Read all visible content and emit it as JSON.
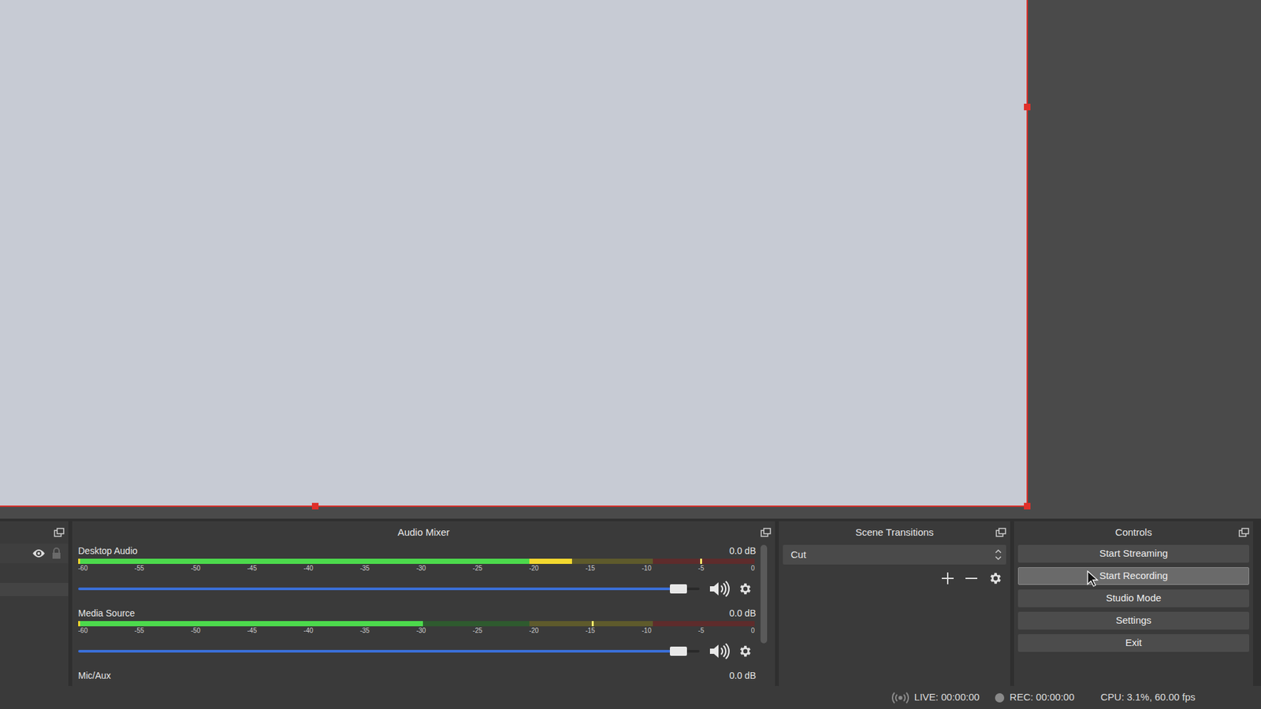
{
  "preview": {
    "selected": true
  },
  "sources_dock": {
    "items": [
      {
        "visible": true,
        "locked": false
      }
    ]
  },
  "audio_mixer": {
    "title": "Audio Mixer",
    "scale": [
      "-60",
      "-55",
      "-50",
      "-45",
      "-40",
      "-35",
      "-30",
      "-25",
      "-20",
      "-15",
      "-10",
      "-5",
      "0"
    ],
    "channels": [
      {
        "name": "Desktop Audio",
        "reading": "0.0 dB",
        "level": 0.73,
        "peak": 0.92,
        "volume": 0.98,
        "muted": false
      },
      {
        "name": "Media Source",
        "reading": "0.0 dB",
        "level": 0.51,
        "peak": 0.76,
        "volume": 0.98,
        "muted": false
      },
      {
        "name": "Mic/Aux",
        "reading": "0.0 dB"
      }
    ]
  },
  "scene_transitions": {
    "title": "Scene Transitions",
    "selected": "Cut"
  },
  "controls": {
    "title": "Controls",
    "buttons": [
      {
        "label": "Start Streaming",
        "hovered": false
      },
      {
        "label": "Start Recording",
        "hovered": true
      },
      {
        "label": "Studio Mode",
        "hovered": false
      },
      {
        "label": "Settings",
        "hovered": false
      },
      {
        "label": "Exit",
        "hovered": false
      }
    ]
  },
  "status_bar": {
    "live": "LIVE: 00:00:00",
    "rec": "REC: 00:00:00",
    "cpu": "CPU: 3.1%, 60.00 fps"
  }
}
